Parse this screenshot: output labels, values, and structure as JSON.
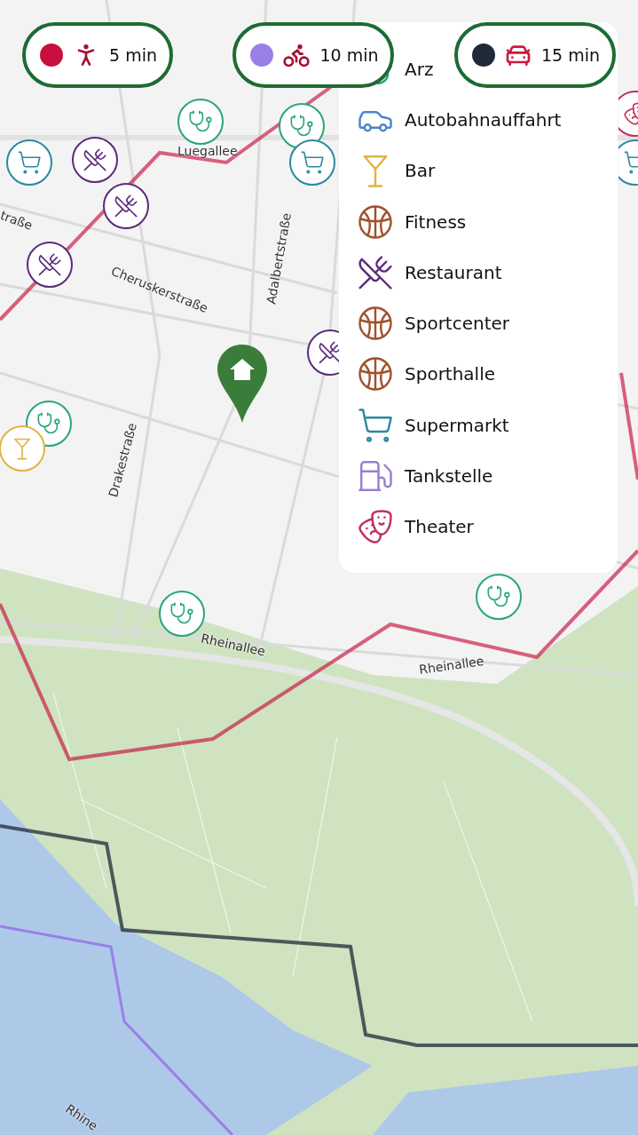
{
  "travel_modes": [
    {
      "kind": "walk",
      "color": "#c8103e",
      "label": "5 min"
    },
    {
      "kind": "bike",
      "color": "#9a7fe6",
      "label": "10 min"
    },
    {
      "kind": "car",
      "color": "#1f2937",
      "label": "15 min"
    }
  ],
  "legend": {
    "items": [
      {
        "kind": "doctor",
        "label": "Arz"
      },
      {
        "kind": "car",
        "label": "Autobahnauffahrt"
      },
      {
        "kind": "bar",
        "label": "Bar"
      },
      {
        "kind": "ball",
        "label": "Fitness"
      },
      {
        "kind": "cutlery",
        "label": "Restaurant"
      },
      {
        "kind": "ball",
        "label": "Sportcenter"
      },
      {
        "kind": "ball",
        "label": "Sporthalle"
      },
      {
        "kind": "cart",
        "label": "Supermarkt"
      },
      {
        "kind": "fuel",
        "label": "Tankstelle"
      },
      {
        "kind": "mask",
        "label": "Theater"
      }
    ]
  },
  "map": {
    "street_labels": [
      "Luegallee",
      "Cheruskerstraße",
      "Adalbertstraße",
      "Drakestraße",
      "Rheinallee",
      "Rheinallee",
      "Rhine",
      "traße"
    ],
    "markers": [
      {
        "kind": "doctor"
      },
      {
        "kind": "doctor"
      },
      {
        "kind": "cart"
      },
      {
        "kind": "cutlery"
      },
      {
        "kind": "cart"
      },
      {
        "kind": "cutlery"
      },
      {
        "kind": "cutlery"
      },
      {
        "kind": "cutlery"
      },
      {
        "kind": "doctor"
      },
      {
        "kind": "bar"
      },
      {
        "kind": "doctor"
      },
      {
        "kind": "doctor"
      },
      {
        "kind": "mask"
      },
      {
        "kind": "cart"
      }
    ],
    "home": {
      "kind": "home"
    }
  }
}
